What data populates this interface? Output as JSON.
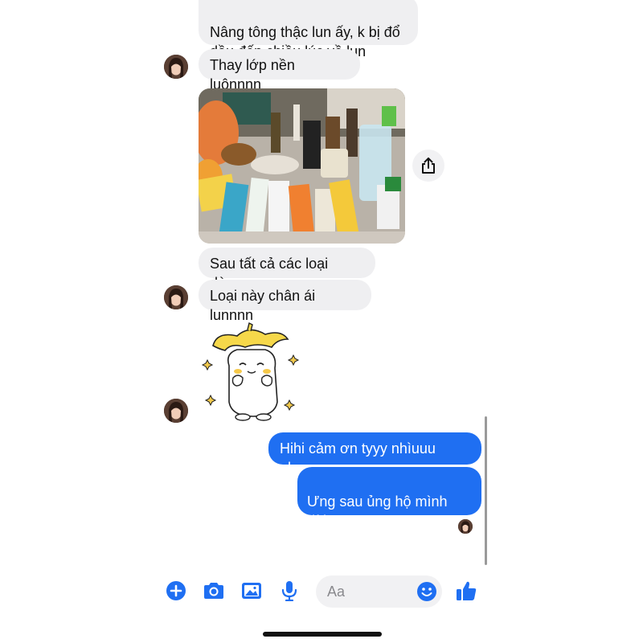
{
  "conversation": {
    "incoming": [
      {
        "text": "Nâng tông thậc lun ấy, k bị đổ\ndầu đến chiều lúc về lun"
      },
      {
        "text": "Thay lớp nền luônnnn"
      },
      {
        "text": "Sau tất cả các loại dùng"
      },
      {
        "text": "Loại này chân ái lunnnn"
      }
    ],
    "outgoing": [
      {
        "text": "Hihi cảm ơn tyyy nhìuuu nhaa"
      },
      {
        "text": "Ưng sau ủng hộ mình dài\ndài nhaaa"
      }
    ],
    "photo": {
      "description_icon": "skincare-products-photo"
    },
    "sticker": {
      "icon": "banana-hat-cat-sticker"
    }
  },
  "composer": {
    "placeholder": "Aa"
  },
  "colors": {
    "accent": "#1f6ff2",
    "incoming_bubble": "#efeff1"
  },
  "icons": {
    "plus": "plus-circle-icon",
    "camera": "camera-icon",
    "gallery": "image-icon",
    "mic": "microphone-icon",
    "emoji": "emoji-icon",
    "like": "thumbs-up-icon",
    "share": "share-icon"
  }
}
